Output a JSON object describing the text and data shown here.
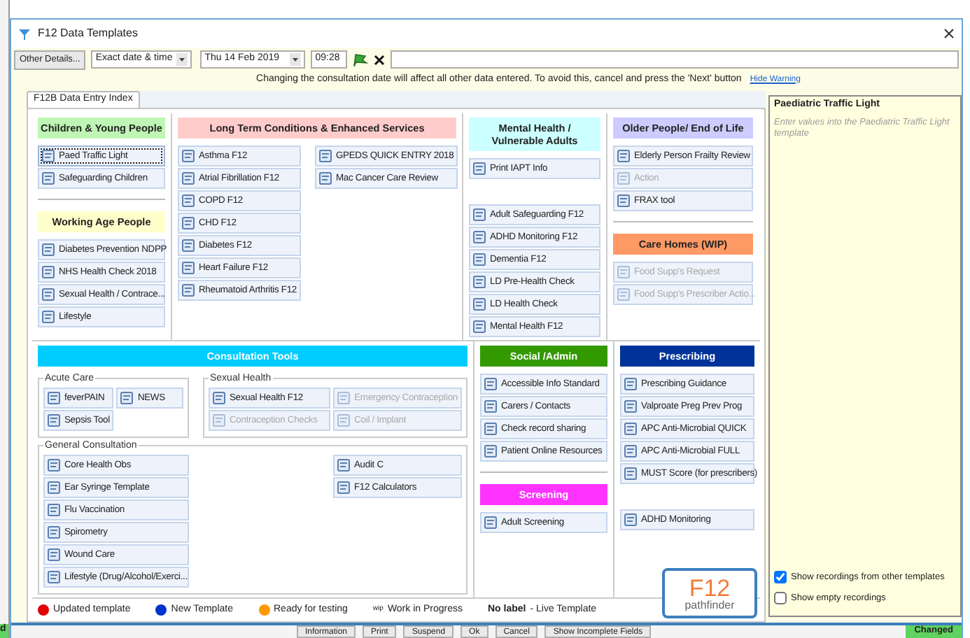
{
  "window": {
    "title": "F12 Data Templates"
  },
  "toolbar": {
    "other_details": "Other Details...",
    "date_mode": "Exact date & time",
    "date": "Thu 14 Feb 2019",
    "time": "09:28"
  },
  "warning": {
    "text": "Changing the consultation date will affect all other data entered. To avoid this, cancel and press the 'Next' button",
    "link": "Hide Warning"
  },
  "tabs": [
    {
      "label": "F12B Data Entry Index",
      "selected": true
    }
  ],
  "top_columns": [
    {
      "sections": [
        {
          "heading": "Children & Young People",
          "color": "#bff5b5",
          "kind": "stacked",
          "groups": [
            [
              {
                "label": "Paed Traffic Light",
                "disabled": false,
                "selected": true
              },
              {
                "label": "Safeguarding Children",
                "disabled": false,
                "selected": false
              }
            ]
          ]
        },
        {
          "heading": "Working Age People",
          "color": "#ffffcc",
          "kind": "stacked",
          "groups": [
            [
              {
                "label": "Diabetes Prevention NDPP",
                "disabled": false,
                "selected": false
              },
              {
                "label": "NHS Health Check  2018",
                "disabled": false,
                "selected": false
              },
              {
                "label": "Sexual Health / Contrace...",
                "disabled": false,
                "selected": false
              },
              {
                "label": "Lifestyle",
                "disabled": false,
                "selected": false
              }
            ]
          ]
        }
      ]
    },
    {
      "sections": [
        {
          "heading": "Long Term Conditions & Enhanced Services",
          "color": "#ffcccc",
          "kind": "columns",
          "groups": [
            [
              {
                "label": "Asthma F12",
                "disabled": false,
                "selected": false
              },
              {
                "label": "Atrial Fibrillation F12",
                "disabled": false,
                "selected": false
              },
              {
                "label": "COPD F12",
                "disabled": false,
                "selected": false
              },
              {
                "label": "CHD F12",
                "disabled": false,
                "selected": false
              },
              {
                "label": "Diabetes F12",
                "disabled": false,
                "selected": false
              },
              {
                "label": "Heart Failure F12",
                "disabled": false,
                "selected": false
              },
              {
                "label": "Rheumatoid Arthritis F12",
                "disabled": false,
                "selected": false
              }
            ],
            [
              {
                "label": "GPEDS QUICK ENTRY 2018",
                "disabled": false,
                "selected": false
              },
              {
                "label": "Mac Cancer Care Review",
                "disabled": false,
                "selected": false
              }
            ]
          ]
        }
      ]
    },
    {
      "sections": [
        {
          "heading": "Mental Health / Vulnerable Adults",
          "color": "#ccffff",
          "kind": "stacked",
          "groups": [
            [
              {
                "label": "Print IAPT Info",
                "disabled": false,
                "selected": false
              }
            ],
            [
              {
                "label": "Adult Safeguarding F12",
                "disabled": false,
                "selected": false
              },
              {
                "label": "ADHD Monitoring F12",
                "disabled": false,
                "selected": false
              },
              {
                "label": "Dementia F12",
                "disabled": false,
                "selected": false
              },
              {
                "label": "LD Pre-Health Check",
                "disabled": false,
                "selected": false
              },
              {
                "label": "LD Health Check",
                "disabled": false,
                "selected": false
              },
              {
                "label": "Mental Health F12",
                "disabled": false,
                "selected": false
              }
            ]
          ]
        }
      ]
    },
    {
      "sections": [
        {
          "heading": "Older People/ End of Life",
          "color": "#ccccff",
          "kind": "stacked",
          "groups": [
            [
              {
                "label": "Elderly Person Frailty Review",
                "disabled": false,
                "selected": false
              },
              {
                "label": "Action",
                "disabled": true,
                "selected": false
              },
              {
                "label": "FRAX tool",
                "disabled": false,
                "selected": false
              }
            ]
          ]
        },
        {
          "heading": "Care Homes (WIP)",
          "color": "#ff9966",
          "kind": "stacked",
          "groups": [
            [
              {
                "label": "Food Supp's Request",
                "disabled": true,
                "selected": false
              },
              {
                "label": "Food Supp's Prescriber Actio...",
                "disabled": true,
                "selected": false
              }
            ]
          ]
        }
      ]
    }
  ],
  "lower_columns": [
    {
      "sections": [
        {
          "heading": "Consultation Tools",
          "color": "#00ccff",
          "kind": "fieldsets",
          "fieldsets": [
            {
              "legend": "Acute Care",
              "columns": [
                [
                  {
                    "label": "feverPAIN",
                    "disabled": false,
                    "selected": false
                  },
                  {
                    "label": "Sepsis Tool",
                    "disabled": false,
                    "selected": false
                  }
                ],
                [
                  {
                    "label": "NEWS",
                    "disabled": false,
                    "selected": false
                  }
                ]
              ]
            },
            {
              "legend": "Sexual Health",
              "columns": [
                [
                  {
                    "label": "Sexual Health F12",
                    "disabled": false,
                    "selected": false
                  },
                  {
                    "label": "Contraception Checks",
                    "disabled": true,
                    "selected": false
                  }
                ],
                [
                  {
                    "label": "Emergency Contraception",
                    "disabled": true,
                    "selected": false
                  },
                  {
                    "label": "Coil / Implant",
                    "disabled": true,
                    "selected": false
                  }
                ]
              ]
            },
            {
              "legend": "General Consultation",
              "columns": [
                [
                  {
                    "label": "Core Health Obs",
                    "disabled": false,
                    "selected": false
                  },
                  {
                    "label": "Ear Syringe Template",
                    "disabled": false,
                    "selected": false
                  },
                  {
                    "label": "Flu Vaccination",
                    "disabled": false,
                    "selected": false
                  },
                  {
                    "label": "Spirometry",
                    "disabled": false,
                    "selected": false
                  },
                  {
                    "label": "Wound Care",
                    "disabled": false,
                    "selected": false
                  },
                  {
                    "label": "Lifestyle (Drug/Alcohol/Exerci...",
                    "disabled": false,
                    "selected": false
                  }
                ],
                [
                  {
                    "label": "Audit C",
                    "disabled": false,
                    "selected": false
                  },
                  {
                    "label": "F12 Calculators",
                    "disabled": false,
                    "selected": false
                  }
                ]
              ]
            }
          ]
        }
      ]
    },
    {
      "sections": [
        {
          "heading": "Social /Admin",
          "color": "#339900",
          "kind": "stacked",
          "groups": [
            [
              {
                "label": "Accessible Info Standard",
                "disabled": false,
                "selected": false
              },
              {
                "label": "Carers / Contacts",
                "disabled": false,
                "selected": false
              },
              {
                "label": "Check record sharing",
                "disabled": false,
                "selected": false
              },
              {
                "label": "Patient Online Resources",
                "disabled": false,
                "selected": false
              }
            ]
          ]
        },
        {
          "heading": "Screening",
          "color": "#ff33ff",
          "kind": "stacked",
          "groups": [
            [
              {
                "label": "Adult Screening",
                "disabled": false,
                "selected": false
              }
            ]
          ]
        }
      ]
    },
    {
      "sections": [
        {
          "heading": "Prescribing",
          "color": "#003399",
          "kind": "stacked",
          "groups": [
            [
              {
                "label": "Prescribing Guidance",
                "disabled": false,
                "selected": false
              },
              {
                "label": "Valproate Preg Prev Prog",
                "disabled": false,
                "selected": false
              },
              {
                "label": "APC Anti-Microbial QUICK",
                "disabled": false,
                "selected": false
              },
              {
                "label": "APC Anti-Microbial FULL",
                "disabled": false,
                "selected": false
              },
              {
                "label": "MUST Score (for prescribers)",
                "disabled": false,
                "selected": false
              }
            ],
            [
              {
                "label": "ADHD Monitoring",
                "disabled": false,
                "selected": false
              }
            ]
          ]
        }
      ]
    }
  ],
  "legend": [
    {
      "kind": "dot",
      "color": "#e00000",
      "label": "Updated template"
    },
    {
      "kind": "dot",
      "color": "#0033cc",
      "label": "New Template"
    },
    {
      "kind": "dot",
      "color": "#ff9900",
      "label": "Ready for testing"
    },
    {
      "kind": "tag",
      "marker": "wip",
      "label": "Work in Progress"
    },
    {
      "kind": "tag",
      "marker": "No label",
      "label": "- Live Template"
    }
  ],
  "logo": {
    "mark": "F12",
    "word": "pathfinder"
  },
  "details": {
    "title": "Paediatric Traffic Light",
    "hint": "Enter values into the Paediatric Traffic Light template",
    "options": [
      {
        "label": "Show recordings from other templates",
        "checked": true
      },
      {
        "label": "Show empty recordings",
        "checked": false
      }
    ]
  },
  "buttons": [
    "Information",
    "Print",
    "Suspend",
    "Ok",
    "Cancel",
    "Show Incomplete Fields"
  ],
  "status": {
    "right": "Changed",
    "left": "d"
  }
}
